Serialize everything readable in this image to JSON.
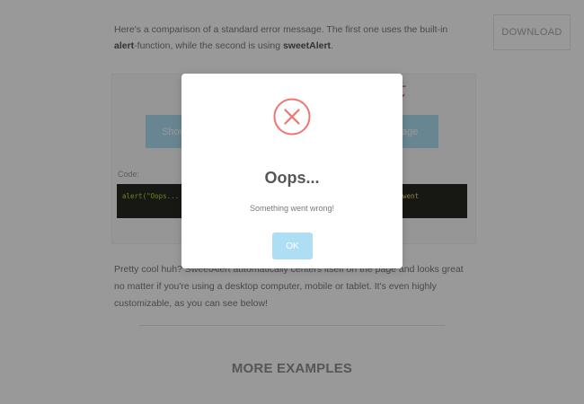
{
  "intro": {
    "text_part1": "Here's a comparison of a standard error message. The first one uses the built-in ",
    "alert_keyword": "alert",
    "text_part2": "-function, while the second is using ",
    "sweet_keyword": "sweetAlert",
    "text_part3": "."
  },
  "header": {
    "download_label": "DOWNLOAD"
  },
  "comparison": {
    "sweet_title_fragment": "t",
    "left_button_label": "Show",
    "right_button_label": "ssage",
    "code_label": "Code:",
    "code_left": "alert(\"Oops... So",
    "code_right": "ing went"
  },
  "after_text": "Pretty cool huh? SweetAlert automatically centers itself on the page and looks great no matter if you're using a desktop computer, mobile or tablet. It's even highly customizable, as you can see below!",
  "more_examples_heading": "MORE EXAMPLES",
  "modal": {
    "icon": "error-x-icon",
    "title": "Oops...",
    "text": "Something went wrong!",
    "ok_label": "OK"
  },
  "colors": {
    "overlay": "rgba(0,0,0,0.4)",
    "error_red": "#f27474",
    "button_blue": "#aedef4",
    "code_bg": "#272822"
  }
}
